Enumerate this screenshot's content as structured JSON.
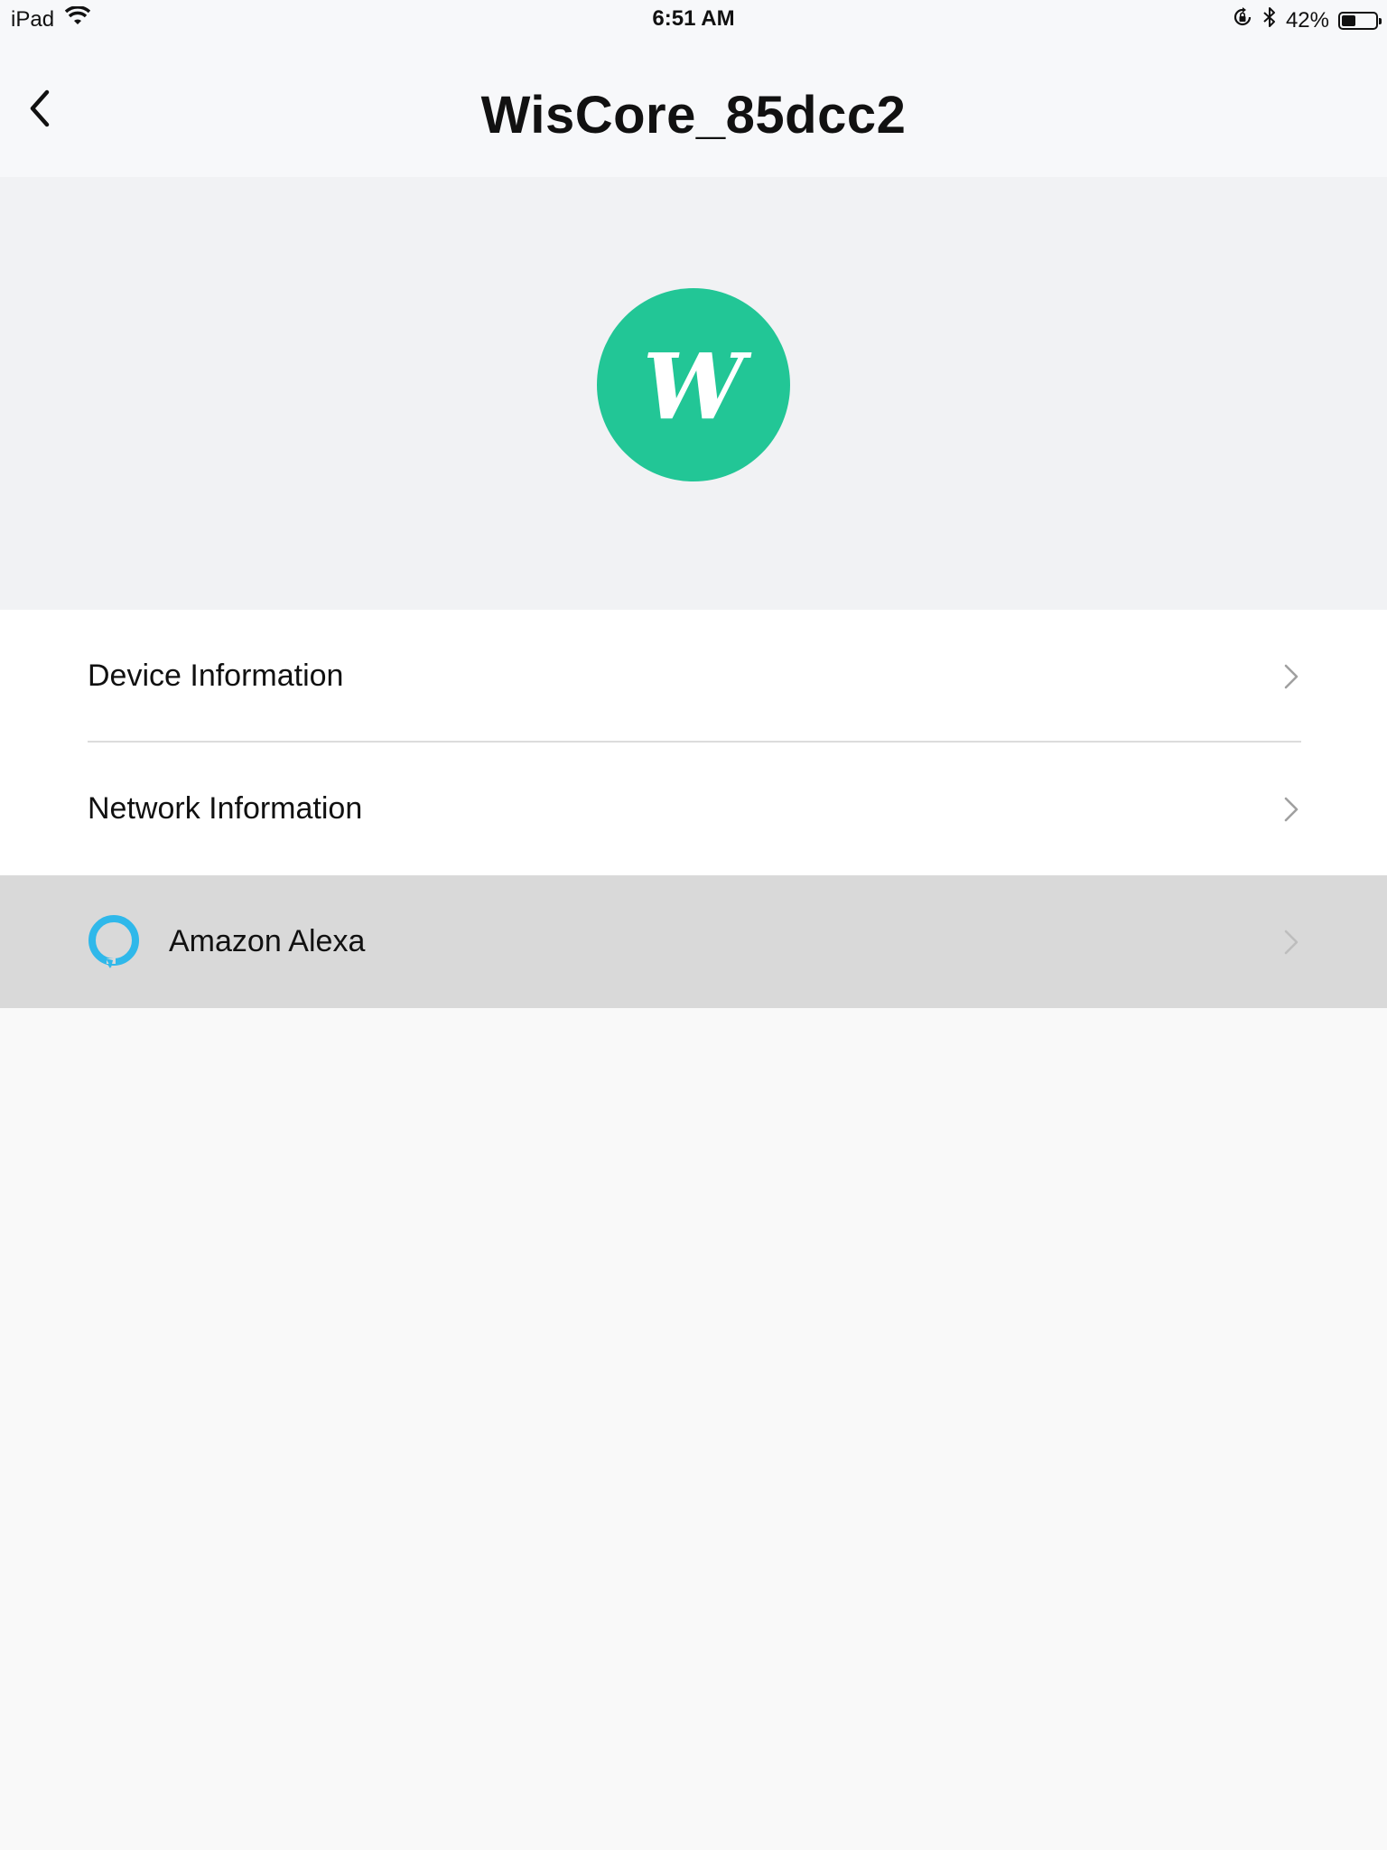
{
  "status_bar": {
    "device": "iPad",
    "time": "6:51 AM",
    "battery_text": "42%",
    "battery_level": 0.42,
    "icons": [
      "wifi-icon",
      "rotation-lock-icon",
      "bluetooth-icon",
      "battery-icon"
    ]
  },
  "nav": {
    "title": "WisCore_85dcc2",
    "back_icon": "chevron-left-icon"
  },
  "hero": {
    "avatar_letter": "W",
    "avatar_color": "#22c696"
  },
  "menu": {
    "items": [
      {
        "label": "Device Information",
        "icon": "chevron-right-icon"
      },
      {
        "label": "Network Information",
        "icon": "chevron-right-icon"
      },
      {
        "label": "Amazon Alexa",
        "icon": "chevron-right-icon",
        "leading_icon": "alexa-ring-icon",
        "highlighted": true
      }
    ]
  },
  "colors": {
    "alexa_blue": "#2fb8ea",
    "highlight": "#d9d9d9"
  }
}
